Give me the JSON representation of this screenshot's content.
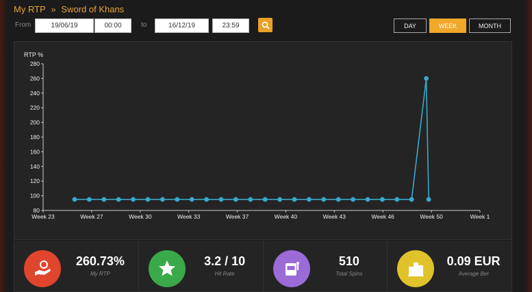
{
  "breadcrumb": {
    "root": "My RTP",
    "separator": "»",
    "current": "Sword of Khans"
  },
  "filters": {
    "from_label": "From",
    "from_date": "19/06/19",
    "from_time": "00:00",
    "to_label": "to",
    "to_date": "16/12/19",
    "to_time": "23:59",
    "search_icon": "search-icon",
    "periods": [
      "DAY",
      "WEEK",
      "MONTH"
    ],
    "active_period": "WEEK"
  },
  "chart_data": {
    "type": "line",
    "ylabel": "RTP %",
    "ylim": [
      80,
      280
    ],
    "yticks": [
      80,
      100,
      120,
      140,
      160,
      180,
      200,
      220,
      240,
      260,
      280
    ],
    "x_tick_labels": [
      "Week 23",
      "Week 27",
      "Week 30",
      "Week 33",
      "Week 37",
      "Week 40",
      "Week 43",
      "Week 46",
      "Week 50",
      "Week 1"
    ],
    "series": [
      {
        "color": "#3aa9c9",
        "values": [
          95,
          95,
          95,
          95,
          95,
          95,
          95,
          95,
          95,
          95,
          95,
          95,
          95,
          95,
          95,
          95,
          95,
          95,
          95,
          95,
          95,
          95,
          95,
          95,
          260,
          95
        ]
      }
    ]
  },
  "stats": [
    {
      "value": "260.73%",
      "label": "My RTP",
      "icon": "hand-coin-icon",
      "color": "#e0452e"
    },
    {
      "value": "3.2 / 10",
      "label": "Hit Rate",
      "icon": "star-icon",
      "color": "#3aa94a"
    },
    {
      "value": "510",
      "label": "Total Spins",
      "icon": "slot-machine-icon",
      "color": "#9b6bd8"
    },
    {
      "value": "0.09 EUR",
      "label": "Average Bet",
      "icon": "coins-stack-icon",
      "color": "#e0c22a"
    }
  ]
}
